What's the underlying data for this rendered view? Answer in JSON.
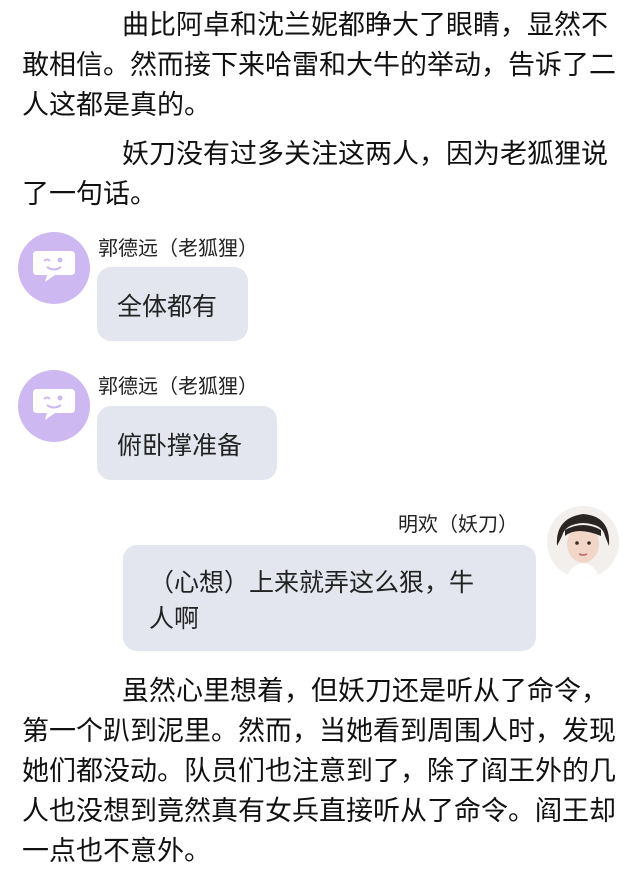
{
  "paragraphs": {
    "p1": "曲比阿卓和沈兰妮都睁大了眼睛，显然不敢相信。然而接下来哈雷和大牛的举动，告诉了二人这都是真的。",
    "p2": "妖刀没有过多关注这两人，因为老狐狸说了一句话。",
    "p3": "虽然心里想着，但妖刀还是听从了命令，第一个趴到泥里。然而，当她看到周围人时，发现她们都没动。队员们也注意到了，除了阎王外的几人也没想到竟然真有女兵直接听从了命令。阎王却一点也不意外。"
  },
  "messages": [
    {
      "speaker": "郭德远（老狐狸）",
      "text": "全体都有",
      "avatar_icon": "chat-bubble-icon"
    },
    {
      "speaker": "郭德远（老狐狸）",
      "text": "俯卧撑准备",
      "avatar_icon": "chat-bubble-icon"
    },
    {
      "speaker": "明欢（妖刀）",
      "text_line1": "（心想）上来就弄这么狠，牛",
      "text_line2": "人啊",
      "avatar_icon": "portrait-photo"
    }
  ],
  "colors": {
    "avatar_bg": "#cdb8f2",
    "bubble_bg": "#e3e6ee"
  }
}
